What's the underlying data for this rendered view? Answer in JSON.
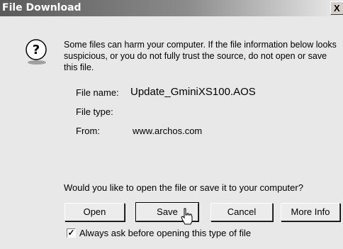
{
  "window": {
    "title": "File Download",
    "close_glyph": "X"
  },
  "warning": {
    "icon": "question-icon",
    "text": "Some files can harm your computer. If the file information below looks suspicious, or you do not fully trust the source, do not open or save this file."
  },
  "file_info": {
    "name_label": "File name:",
    "name_value": "Update_GminiXS100.AOS",
    "type_label": "File type:",
    "type_value": "",
    "from_label": "From:",
    "from_value": "www.archos.com"
  },
  "question": "Would you like to open the file or save it to your computer?",
  "buttons": {
    "open": "Open",
    "save": "Save",
    "cancel": "Cancel",
    "more_info": "More Info"
  },
  "checkbox": {
    "label": "Always ask before opening this type of file",
    "checked": true,
    "mark": "✓"
  }
}
